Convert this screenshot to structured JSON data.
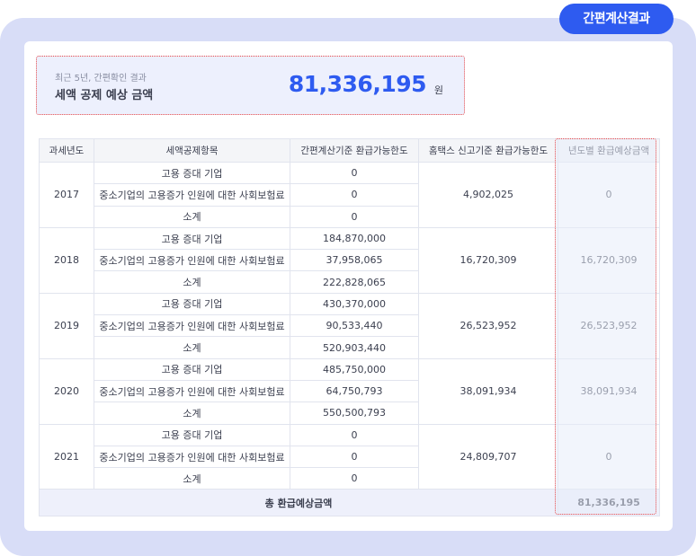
{
  "badge_label": "간편계산결과",
  "summary": {
    "subtitle": "최근 5년, 간편확인 결과",
    "title": "세액 공제 예상 금액",
    "amount": "81,336,195",
    "unit": "원"
  },
  "table": {
    "headers": [
      "과세년도",
      "세액공제항목",
      "간편계산기준 환급가능한도",
      "홈택스 신고기준 환급가능한도",
      "년도별 환급예상금액"
    ],
    "years": [
      {
        "year": "2017",
        "items": [
          {
            "label": "고용 증대 기업",
            "value": "0"
          },
          {
            "label": "중소기업의 고용증가 인원에 대한 사회보험료",
            "value": "0"
          },
          {
            "label": "소계",
            "value": "0"
          }
        ],
        "hometax_limit": "4,902,025",
        "refund": "0"
      },
      {
        "year": "2018",
        "items": [
          {
            "label": "고용 증대 기업",
            "value": "184,870,000"
          },
          {
            "label": "중소기업의 고용증가 인원에 대한 사회보험료",
            "value": "37,958,065"
          },
          {
            "label": "소계",
            "value": "222,828,065"
          }
        ],
        "hometax_limit": "16,720,309",
        "refund": "16,720,309"
      },
      {
        "year": "2019",
        "items": [
          {
            "label": "고용 증대 기업",
            "value": "430,370,000"
          },
          {
            "label": "중소기업의 고용증가 인원에 대한 사회보험료",
            "value": "90,533,440"
          },
          {
            "label": "소계",
            "value": "520,903,440"
          }
        ],
        "hometax_limit": "26,523,952",
        "refund": "26,523,952"
      },
      {
        "year": "2020",
        "items": [
          {
            "label": "고용 증대 기업",
            "value": "485,750,000"
          },
          {
            "label": "중소기업의 고용증가 인원에 대한 사회보험료",
            "value": "64,750,793"
          },
          {
            "label": "소계",
            "value": "550,500,793"
          }
        ],
        "hometax_limit": "38,091,934",
        "refund": "38,091,934"
      },
      {
        "year": "2021",
        "items": [
          {
            "label": "고용 증대 기업",
            "value": "0"
          },
          {
            "label": "중소기업의 고용증가 인원에 대한 사회보험료",
            "value": "0"
          },
          {
            "label": "소계",
            "value": "0"
          }
        ],
        "hometax_limit": "24,809,707",
        "refund": "0"
      }
    ],
    "total_label": "총 환급예상금액",
    "total_value": "81,336,195"
  },
  "colors": {
    "accent": "#2e5bf0",
    "frame_bg": "#d8ddf7",
    "highlight_border": "#e84a4a",
    "summary_bg": "#edf0fd"
  }
}
